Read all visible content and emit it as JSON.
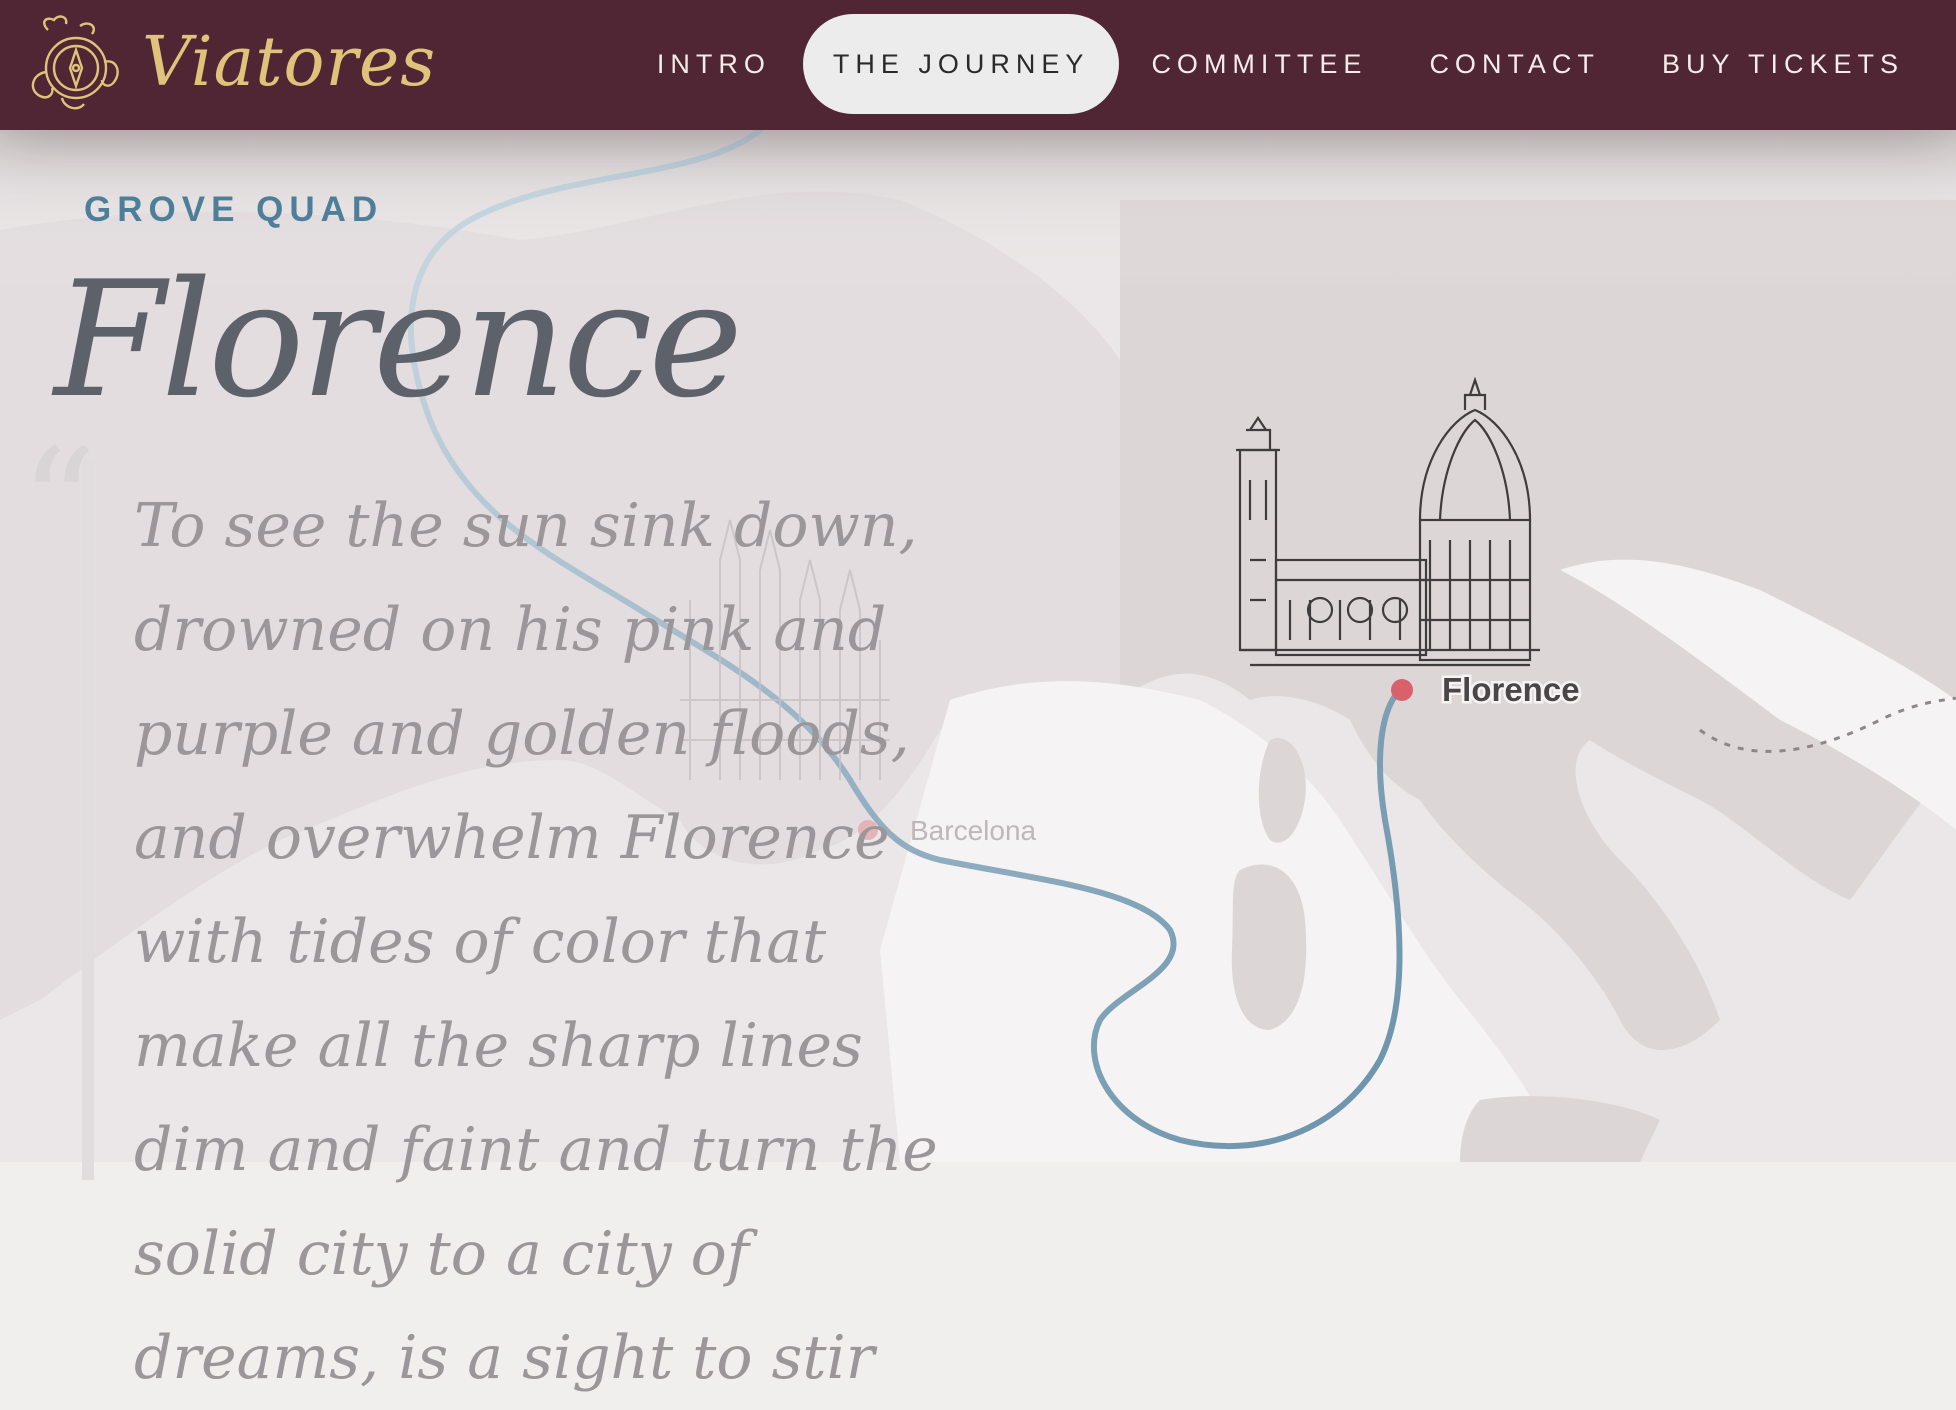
{
  "header": {
    "brand": "Viatores",
    "nav": [
      {
        "label": "INTRO",
        "active": false
      },
      {
        "label": "THE JOURNEY",
        "active": true
      },
      {
        "label": "COMMITTEE",
        "active": false
      },
      {
        "label": "CONTACT",
        "active": false
      },
      {
        "label": "BUY TICKETS",
        "active": false
      }
    ]
  },
  "section": {
    "eyebrow": "GROVE QUAD",
    "title": "Florence",
    "quote_mark": "“",
    "quote": "To see the sun sink down, drowned on his pink and purple and golden floods, and overwhelm Florence with tides of color that make all the sharp lines dim and faint and turn the solid city to a city of dreams, is a sight to stir"
  },
  "map": {
    "labels": {
      "current": "Florence",
      "previous": "Barcelona"
    }
  },
  "colors": {
    "header_bg": "#502635",
    "brand_gold": "#e0c27a",
    "accent_blue": "#4e7f99",
    "route_blue": "#5a87a2",
    "marker_red": "#d9616c",
    "land": "#ddd6d7"
  }
}
